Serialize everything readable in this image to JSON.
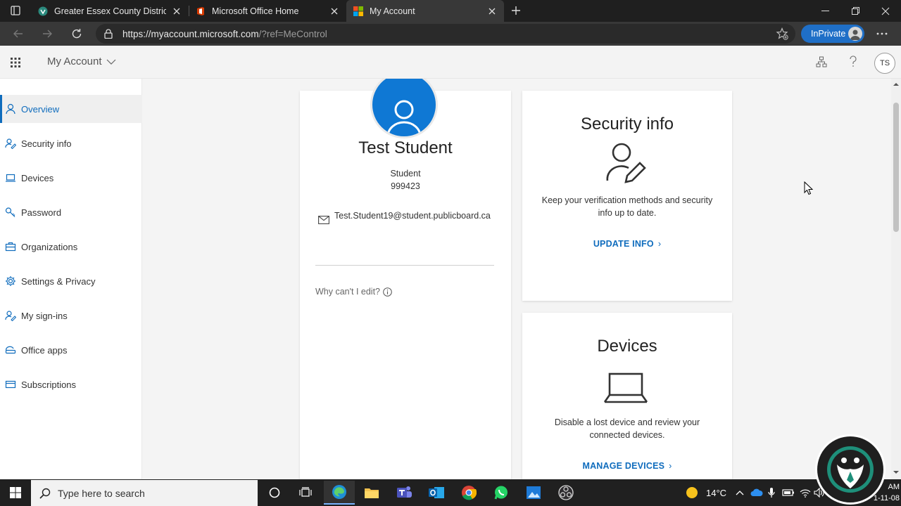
{
  "browser": {
    "tabs": [
      {
        "title": "Greater Essex County District Sch",
        "favicon": "shield-favicon"
      },
      {
        "title": "Microsoft Office Home",
        "favicon": "office-favicon"
      },
      {
        "title": "My Account",
        "favicon": "microsoft-favicon",
        "active": true
      }
    ],
    "url_host": "https://myaccount.microsoft.com",
    "url_path": "/?ref=MeControl",
    "inprivate_label": "InPrivate"
  },
  "header": {
    "app_title": "My Account",
    "user_initials": "TS"
  },
  "sidebar": {
    "items": [
      {
        "label": "Overview",
        "icon": "person-icon",
        "active": true
      },
      {
        "label": "Security info",
        "icon": "person-key-icon"
      },
      {
        "label": "Devices",
        "icon": "laptop-icon"
      },
      {
        "label": "Password",
        "icon": "key-icon"
      },
      {
        "label": "Organizations",
        "icon": "briefcase-icon"
      },
      {
        "label": "Settings & Privacy",
        "icon": "gear-icon"
      },
      {
        "label": "My sign-ins",
        "icon": "person-key-icon"
      },
      {
        "label": "Office apps",
        "icon": "apps-icon"
      },
      {
        "label": "Subscriptions",
        "icon": "card-icon"
      }
    ]
  },
  "profile": {
    "name": "Test Student",
    "role": "Student",
    "id": "999423",
    "email": "Test.Student19@student.publicboard.ca",
    "why_edit": "Why can't I edit?"
  },
  "cards": {
    "security": {
      "title": "Security info",
      "description": "Keep your verification methods and security info up to date.",
      "link": "UPDATE INFO"
    },
    "devices": {
      "title": "Devices",
      "description": "Disable a lost device and review your connected devices.",
      "link": "MANAGE DEVICES"
    }
  },
  "taskbar": {
    "search_placeholder": "Type here to search",
    "temperature": "14°C",
    "clock_time": "AM",
    "clock_date": "1-11-08"
  },
  "colors": {
    "accent": "#0f6cbd",
    "avatar_blue": "#0f78d4",
    "inprivate_blue": "#1f6fc7"
  }
}
